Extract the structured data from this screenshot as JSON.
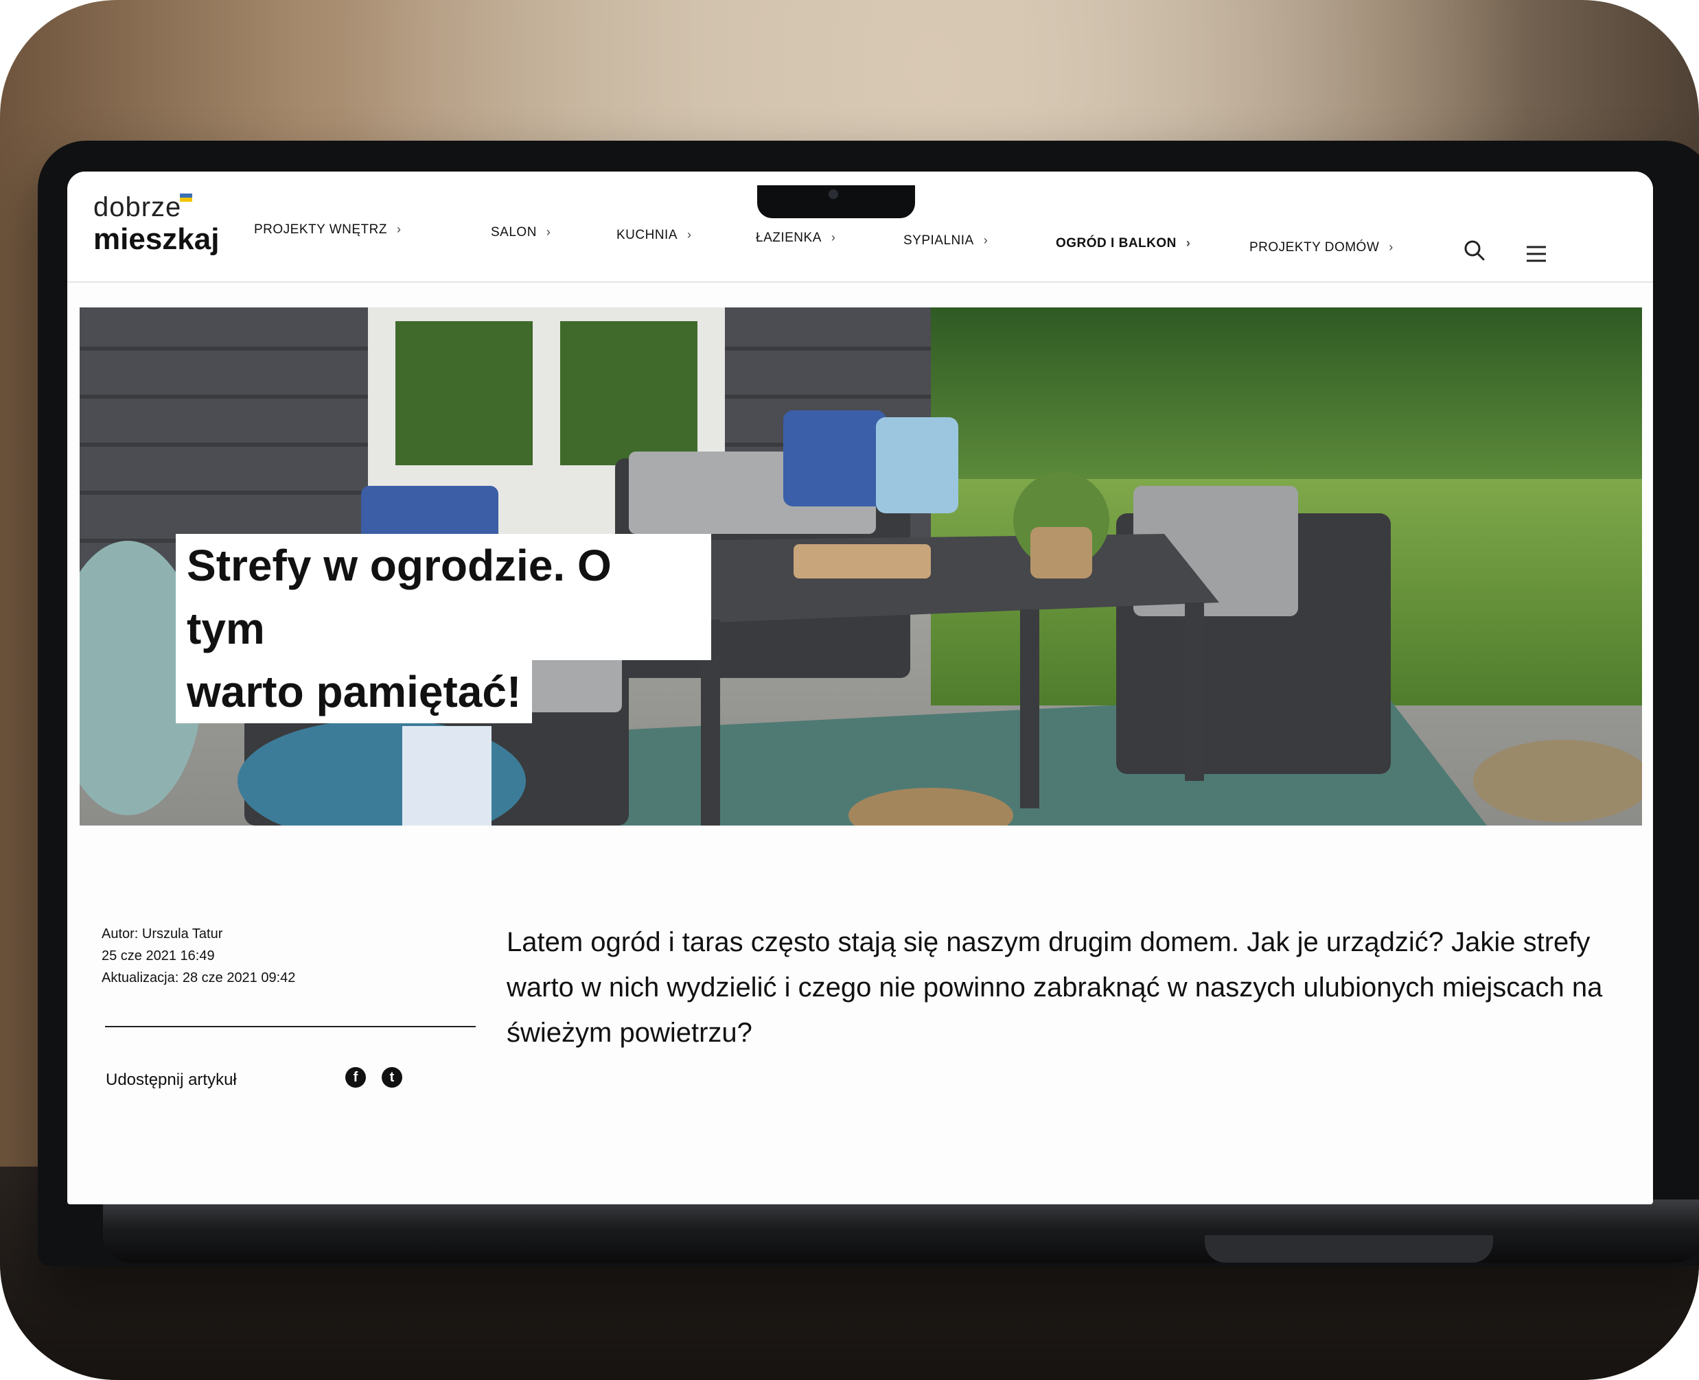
{
  "logo": {
    "top": "dobrze",
    "bottom": "mieszkaj"
  },
  "nav": {
    "items": [
      {
        "label": "PROJEKTY WNĘTRZ"
      },
      {
        "label": "SALON"
      },
      {
        "label": "KUCHNIA"
      },
      {
        "label": "ŁAZIENKA"
      },
      {
        "label": "SYPIALNIA"
      },
      {
        "label": "OGRÓD I BALKON",
        "active": true
      },
      {
        "label": "PROJEKTY DOMÓW"
      }
    ],
    "chevron": "›"
  },
  "icons": {
    "search": "search-icon",
    "menu": "hamburger-menu-icon",
    "facebook": "facebook-icon",
    "twitter": "twitter-icon"
  },
  "hero": {
    "title_line1": "Strefy w ogrodzie. O tym",
    "title_line2": "warto pamiętać!"
  },
  "meta": {
    "author": "Autor: Urszula Tatur",
    "published": "25 cze 2021 16:49",
    "updated": "Aktualizacja: 28 cze 2021 09:42"
  },
  "share": {
    "label": "Udostępnij artykuł",
    "facebook_glyph": "f",
    "twitter_glyph": "t"
  },
  "lead": "Latem ogród i taras często stają się naszym drugim domem. Jak je urządzić? Jakie strefy warto w nich wydzielić i czego nie powinno zabraknąć w naszych ulubionych miejscach na świeżym powietrzu?",
  "colors": {
    "flag_blue": "#3b6fb6",
    "flag_yellow": "#f2c500",
    "text": "#111111"
  }
}
